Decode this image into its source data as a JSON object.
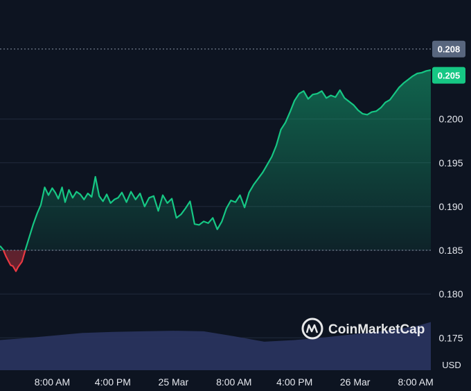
{
  "chart_data": {
    "type": "area",
    "title": "",
    "watermark": "CoinMarketCap",
    "unit_label": "USD",
    "y_ticks": [
      "0.175",
      "0.180",
      "0.185",
      "0.190",
      "0.195",
      "0.200"
    ],
    "ylim": [
      0.1713,
      0.2136
    ],
    "x_ticks": [
      "8:00 AM",
      "4:00 PM",
      "25 Mar",
      "8:00 AM",
      "4:00 PM",
      "26 Mar",
      "8:00 AM"
    ],
    "x_tick_hours": [
      8,
      16,
      24,
      32,
      40,
      48,
      56
    ],
    "x_range_hours": [
      1.1,
      58.0
    ],
    "grid": true,
    "baseline": 0.185,
    "high_price": 0.208,
    "high_price_label": "0.208",
    "current_price": 0.205,
    "current_price_label": "0.205",
    "colors": {
      "up": "#16c784",
      "down": "#ea3943",
      "volume": "#2a3461",
      "badge_high": "#58667e",
      "badge_current": "#16c784"
    },
    "series": [
      {
        "x": [
          1.1,
          1.5,
          1.9,
          2.2,
          2.5,
          2.8,
          3.2,
          3.5,
          4.0,
          4.5,
          5.0,
          5.5,
          6.0,
          6.5,
          7.0,
          7.5,
          8.0,
          8.4,
          8.8,
          9.3,
          9.7,
          10.2,
          10.7,
          11.2,
          11.7,
          12.2,
          12.7,
          13.2,
          13.7,
          14.2,
          14.7,
          15.2,
          15.7,
          16.2,
          16.7,
          17.2,
          17.8,
          18.4,
          19.0,
          19.6,
          20.2,
          20.8,
          21.4,
          22.0,
          22.6,
          23.2,
          23.8,
          24.4,
          25.0,
          25.6,
          26.2,
          26.8,
          27.4,
          28.0,
          28.6,
          29.2,
          29.8,
          30.4,
          31.0,
          31.6,
          32.2,
          32.8,
          33.4,
          34.0,
          34.6,
          35.2,
          35.8,
          36.4,
          37.0,
          37.6,
          38.2,
          38.8,
          39.4,
          40.0,
          40.6,
          41.2,
          41.8,
          42.4,
          43.0,
          43.6,
          44.2,
          44.8,
          45.4,
          46.0,
          46.6,
          47.2,
          47.8,
          48.4,
          49.0,
          49.6,
          50.2,
          50.8,
          51.4,
          52.0,
          52.6,
          53.2,
          53.8,
          54.4,
          55.0,
          55.6,
          56.2,
          56.8,
          57.4,
          58.0
        ],
        "values": [
          0.1855,
          0.1851,
          0.1843,
          0.1838,
          0.1833,
          0.1832,
          0.1826,
          0.1831,
          0.1837,
          0.1852,
          0.1866,
          0.188,
          0.1892,
          0.1902,
          0.1922,
          0.1913,
          0.1921,
          0.1916,
          0.1909,
          0.1922,
          0.1905,
          0.1919,
          0.191,
          0.1917,
          0.1914,
          0.1908,
          0.1915,
          0.1911,
          0.1934,
          0.1912,
          0.1906,
          0.1914,
          0.1904,
          0.1908,
          0.191,
          0.1916,
          0.1905,
          0.1917,
          0.1908,
          0.1915,
          0.19,
          0.191,
          0.1912,
          0.1895,
          0.1913,
          0.1904,
          0.1909,
          0.1887,
          0.1891,
          0.1898,
          0.1906,
          0.188,
          0.1879,
          0.1883,
          0.1881,
          0.1887,
          0.1874,
          0.1883,
          0.1898,
          0.1907,
          0.1905,
          0.1913,
          0.1899,
          0.1916,
          0.1925,
          0.1932,
          0.1939,
          0.1948,
          0.1957,
          0.197,
          0.1988,
          0.1996,
          0.2008,
          0.2021,
          0.2029,
          0.2032,
          0.2023,
          0.2028,
          0.2029,
          0.2032,
          0.2024,
          0.2027,
          0.2025,
          0.2033,
          0.2024,
          0.202,
          0.2016,
          0.201,
          0.2006,
          0.2005,
          0.2008,
          0.2009,
          0.2013,
          0.2019,
          0.2022,
          0.2029,
          0.2036,
          0.2041,
          0.2045,
          0.2049,
          0.2052,
          0.2053,
          0.2055,
          0.2056
        ]
      }
    ],
    "volume": {
      "x": [
        1.1,
        4.0,
        8.0,
        12.0,
        16.0,
        20.0,
        24.0,
        28.0,
        32.0,
        36.0,
        40.0,
        44.0,
        48.0,
        52.0,
        56.0,
        58.0
      ],
      "values": [
        0.55,
        0.58,
        0.63,
        0.68,
        0.7,
        0.71,
        0.72,
        0.71,
        0.62,
        0.52,
        0.55,
        0.6,
        0.66,
        0.72,
        0.8,
        0.88
      ]
    }
  }
}
